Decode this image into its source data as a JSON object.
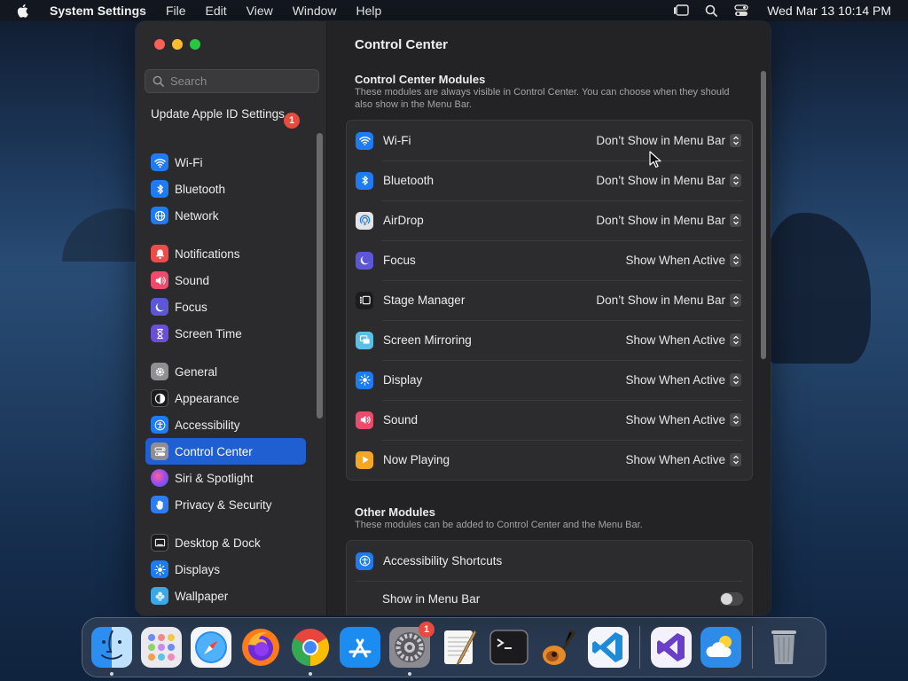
{
  "menubar": {
    "app_name": "System Settings",
    "menus": [
      "File",
      "Edit",
      "View",
      "Window",
      "Help"
    ],
    "clock": "Wed Mar 13  10:14 PM"
  },
  "sidebar": {
    "search_placeholder": "Search",
    "apple_id_label": "Update Apple ID Settings",
    "apple_id_badge": "1",
    "items": [
      {
        "label": "Wi-Fi",
        "icon": "wifi-icon",
        "color": "#1e7bf2"
      },
      {
        "label": "Bluetooth",
        "icon": "bluetooth-icon",
        "color": "#1e7bf2"
      },
      {
        "label": "Network",
        "icon": "globe-icon",
        "color": "#1e7bf2"
      },
      {
        "label": "Notifications",
        "icon": "bell-icon",
        "color": "#ee4b4b"
      },
      {
        "label": "Sound",
        "icon": "speaker-icon",
        "color": "#ee4b6c"
      },
      {
        "label": "Focus",
        "icon": "moon-icon",
        "color": "#5b57d6"
      },
      {
        "label": "Screen Time",
        "icon": "hourglass-icon",
        "color": "#6a4fd8"
      },
      {
        "label": "General",
        "icon": "gear-icon",
        "color": "#8e8e93"
      },
      {
        "label": "Appearance",
        "icon": "appearance-icon",
        "color": "#1c1c1e"
      },
      {
        "label": "Accessibility",
        "icon": "accessibility-icon",
        "color": "#1e7bf2"
      },
      {
        "label": "Control Center",
        "icon": "toggles-icon",
        "color": "#8e8e93"
      },
      {
        "label": "Siri & Spotlight",
        "icon": "siri-icon",
        "color": "#c04de0"
      },
      {
        "label": "Privacy & Security",
        "icon": "hand-icon",
        "color": "#2f7bf0"
      },
      {
        "label": "Desktop & Dock",
        "icon": "desktop-icon",
        "color": "#1c1c1e"
      },
      {
        "label": "Displays",
        "icon": "sun-icon",
        "color": "#1e7bf2"
      },
      {
        "label": "Wallpaper",
        "icon": "flower-icon",
        "color": "#3aa8e8"
      }
    ]
  },
  "main": {
    "title": "Control Center",
    "modules_title": "Control Center Modules",
    "modules_desc": "These modules are always visible in Control Center. You can choose when they should also show in the Menu Bar.",
    "modules": [
      {
        "label": "Wi-Fi",
        "value": "Don’t Show in Menu Bar",
        "icon": "wifi-icon",
        "color": "#1e7bf2"
      },
      {
        "label": "Bluetooth",
        "value": "Don’t Show in Menu Bar",
        "icon": "bluetooth-icon",
        "color": "#1e7bf2"
      },
      {
        "label": "AirDrop",
        "value": "Don’t Show in Menu Bar",
        "icon": "airdrop-icon",
        "color": "#e4e4e8"
      },
      {
        "label": "Focus",
        "value": "Show When Active",
        "icon": "moon-icon",
        "color": "#5b57d6"
      },
      {
        "label": "Stage Manager",
        "value": "Don’t Show in Menu Bar",
        "icon": "stage-manager-icon",
        "color": "#1c1c1e"
      },
      {
        "label": "Screen Mirroring",
        "value": "Show When Active",
        "icon": "screen-mirroring-icon",
        "color": "#5bc0e8"
      },
      {
        "label": "Display",
        "value": "Show When Active",
        "icon": "sun-icon",
        "color": "#1e7bf2"
      },
      {
        "label": "Sound",
        "value": "Show When Active",
        "icon": "speaker-icon",
        "color": "#ee4b6c"
      },
      {
        "label": "Now Playing",
        "value": "Show When Active",
        "icon": "play-icon",
        "color": "#f5a623"
      }
    ],
    "other_title": "Other Modules",
    "other_desc": "These modules can be added to Control Center and the Menu Bar.",
    "other": [
      {
        "label": "Accessibility Shortcuts",
        "icon": "accessibility-icon",
        "color": "#1e7bf2"
      }
    ],
    "show_in_menu_bar_label": "Show in Menu Bar",
    "show_in_menu_bar_on": false
  },
  "dock": {
    "items": [
      {
        "name": "finder",
        "running": true
      },
      {
        "name": "launchpad",
        "running": false
      },
      {
        "name": "safari",
        "running": false
      },
      {
        "name": "firefox",
        "running": false
      },
      {
        "name": "chrome",
        "running": true
      },
      {
        "name": "app-store",
        "running": false
      },
      {
        "name": "system-settings",
        "running": true,
        "badge": "1"
      },
      {
        "name": "textedit",
        "running": false
      },
      {
        "name": "terminal",
        "running": false
      },
      {
        "name": "garageband",
        "running": false
      },
      {
        "name": "vscode",
        "running": false
      },
      {
        "name": "visual-studio",
        "running": false
      },
      {
        "name": "weather",
        "running": false
      },
      {
        "name": "trash",
        "running": false
      }
    ]
  }
}
